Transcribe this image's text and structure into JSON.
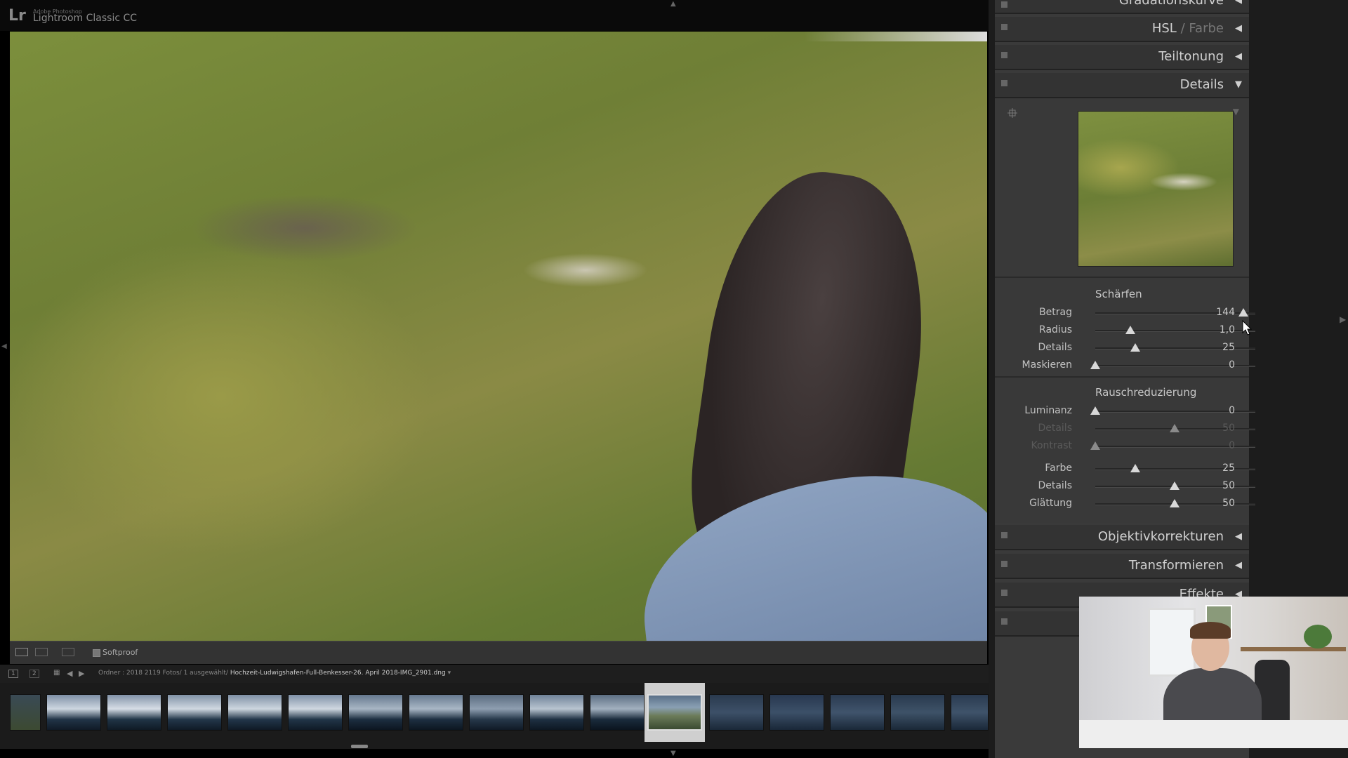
{
  "app": {
    "vendor": "Adobe Photoshop",
    "product": "Lightroom Classic CC",
    "logo": "Lr"
  },
  "toolbar": {
    "softproof_label": "Softproof"
  },
  "filmstrip": {
    "page1": "1",
    "page2": "2",
    "folder_prefix": "Ordner : 2018",
    "counts": "2119 Fotos/ 1 ausgewählt/",
    "filename": "Hochzeit-Ludwigshafen-Full-Benkesser-26. April 2018-IMG_2901.dng",
    "dropdown": "▾"
  },
  "panels": {
    "gradation": "Gradationskurve",
    "hsl_main": "HSL",
    "hsl_sep": " / ",
    "hsl_dim": "Farbe",
    "teiltonung": "Teiltonung",
    "details": "Details",
    "objektiv": "Objektivkorrekturen",
    "transform": "Transformieren",
    "effekte": "Effekte"
  },
  "details": {
    "schaerfen_title": "Schärfen",
    "rausch_title": "Rauschreduzierung",
    "schaerfen": [
      {
        "label": "Betrag",
        "value": "144",
        "pos": 0.9333
      },
      {
        "label": "Radius",
        "value": "1,0",
        "pos": 0.2222
      },
      {
        "label": "Details",
        "value": "25",
        "pos": 0.25
      },
      {
        "label": "Maskieren",
        "value": "0",
        "pos": 0.0
      }
    ],
    "rausch": [
      {
        "label": "Luminanz",
        "value": "0",
        "pos": 0.0
      },
      {
        "label": "Details",
        "value": "50",
        "pos": 0.5
      },
      {
        "label": "Kontrast",
        "value": "0",
        "pos": 0.0
      }
    ],
    "farbe": [
      {
        "label": "Farbe",
        "value": "25",
        "pos": 0.25
      },
      {
        "label": "Details",
        "value": "50",
        "pos": 0.5
      },
      {
        "label": "Glättung",
        "value": "50",
        "pos": 0.5
      }
    ]
  },
  "colors": {
    "panel_bg": "#3a3a3a",
    "header_text": "#d0d0d0",
    "selected_thumb": "#cfcfcf"
  },
  "icons": {
    "collapse": "◀",
    "expand": "▼",
    "up": "▲",
    "down": "▼"
  }
}
